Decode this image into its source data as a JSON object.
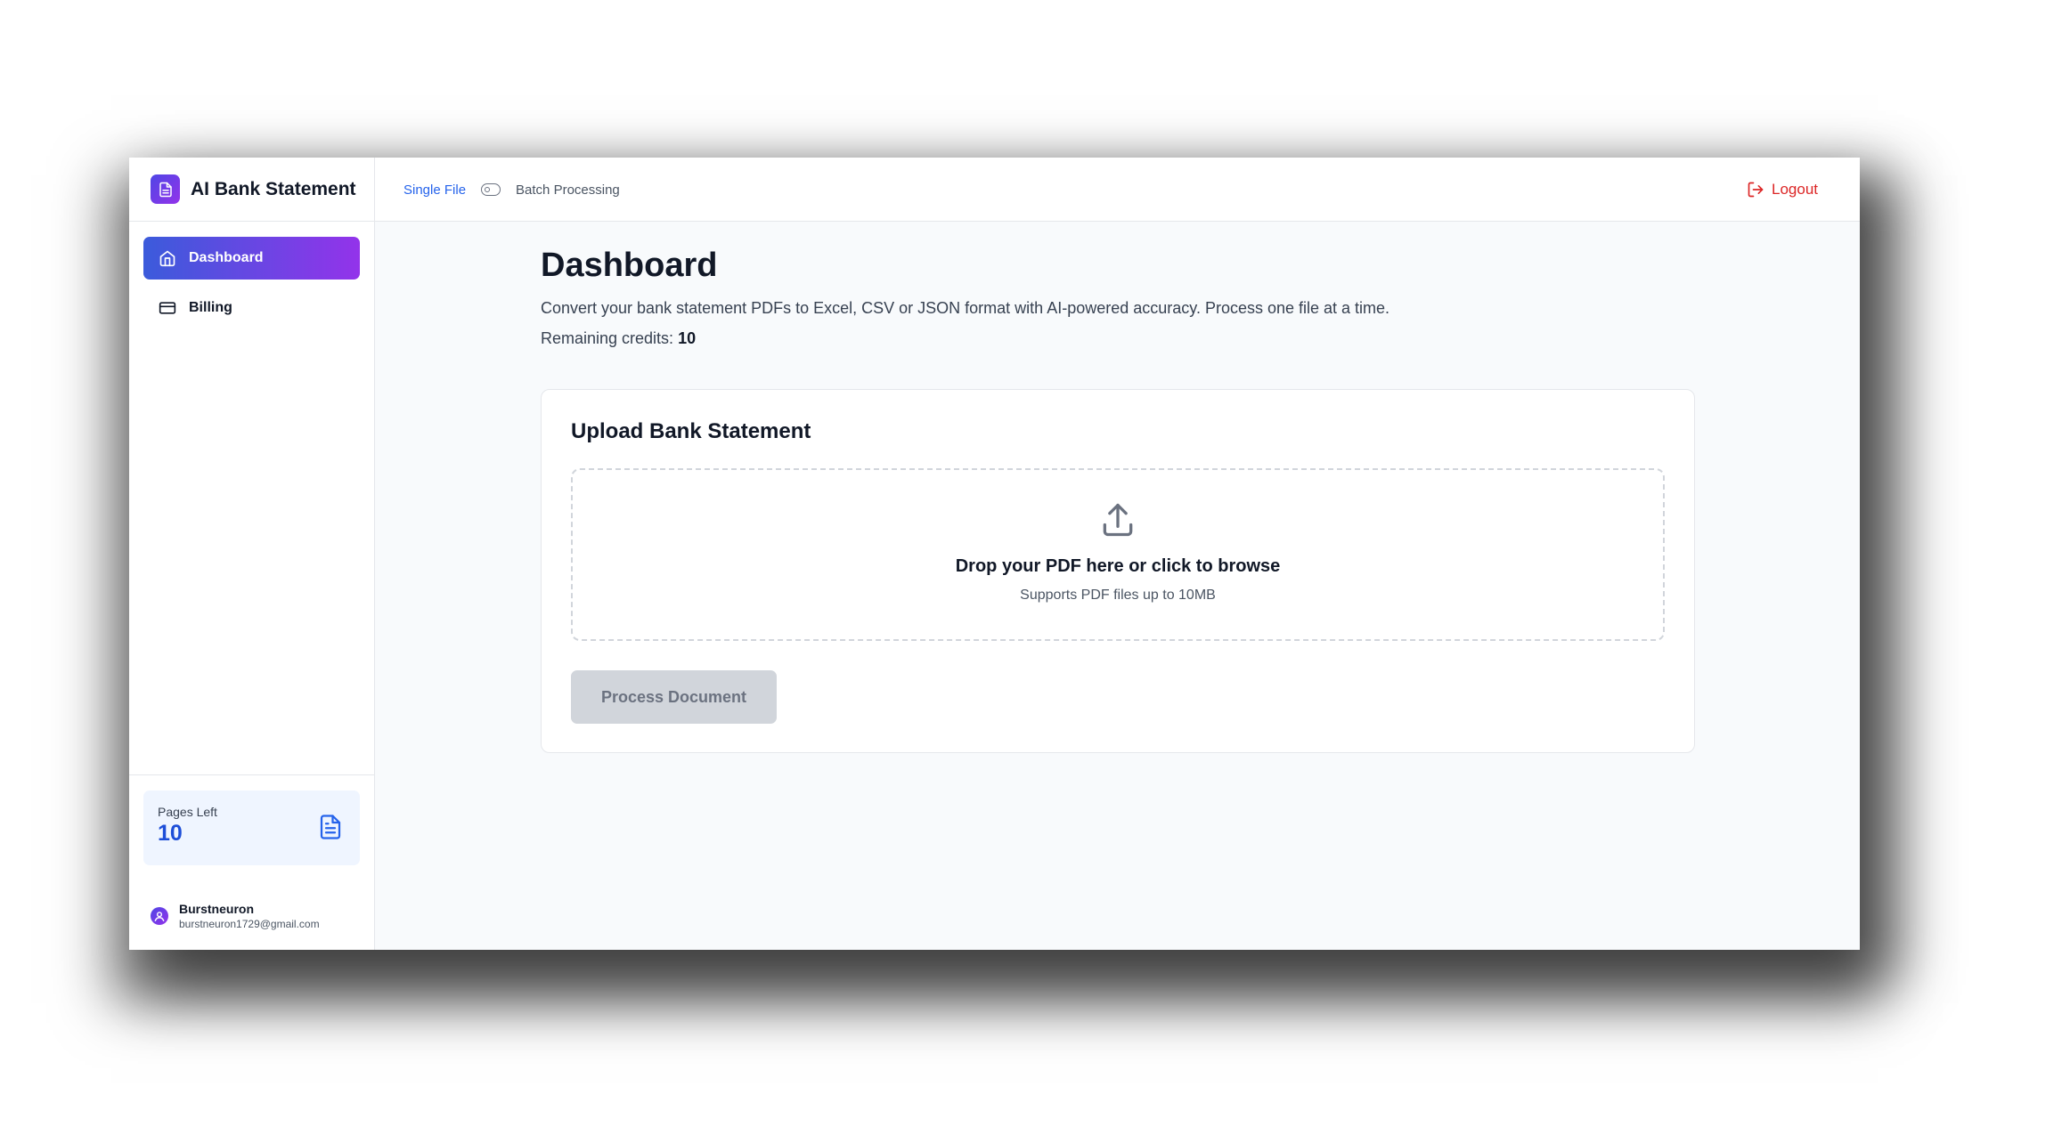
{
  "brand": {
    "name": "AI Bank Statement"
  },
  "sidebar": {
    "items": [
      {
        "label": "Dashboard",
        "icon": "home-icon",
        "active": true
      },
      {
        "label": "Billing",
        "icon": "credit-card-icon",
        "active": false
      }
    ],
    "pages_card": {
      "label": "Pages Left",
      "value": "10",
      "icon": "document-icon"
    },
    "user": {
      "name": "Burstneuron",
      "email": "burstneuron1729@gmail.com",
      "icon": "user-avatar-icon"
    }
  },
  "topbar": {
    "mode_single": "Single File",
    "mode_batch": "Batch Processing",
    "toggle_icon": "toggle-icon",
    "logout_label": "Logout",
    "logout_icon": "logout-icon"
  },
  "main": {
    "title": "Dashboard",
    "description": "Convert your bank statement PDFs to Excel, CSV or JSON format with AI-powered accuracy. Process one file at a time.",
    "credits_label": "Remaining credits:",
    "credits_value": "10",
    "upload": {
      "title": "Upload Bank Statement",
      "drop_title": "Drop your PDF here or click to browse",
      "drop_sub": "Supports PDF files up to 10MB",
      "icon": "upload-icon",
      "button_label": "Process Document"
    }
  },
  "colors": {
    "accent_blue": "#2563eb",
    "gradient_start": "#3b5bdb",
    "gradient_end": "#9333ea",
    "logout_red": "#dc2626",
    "disabled_button": "#d1d5db"
  }
}
